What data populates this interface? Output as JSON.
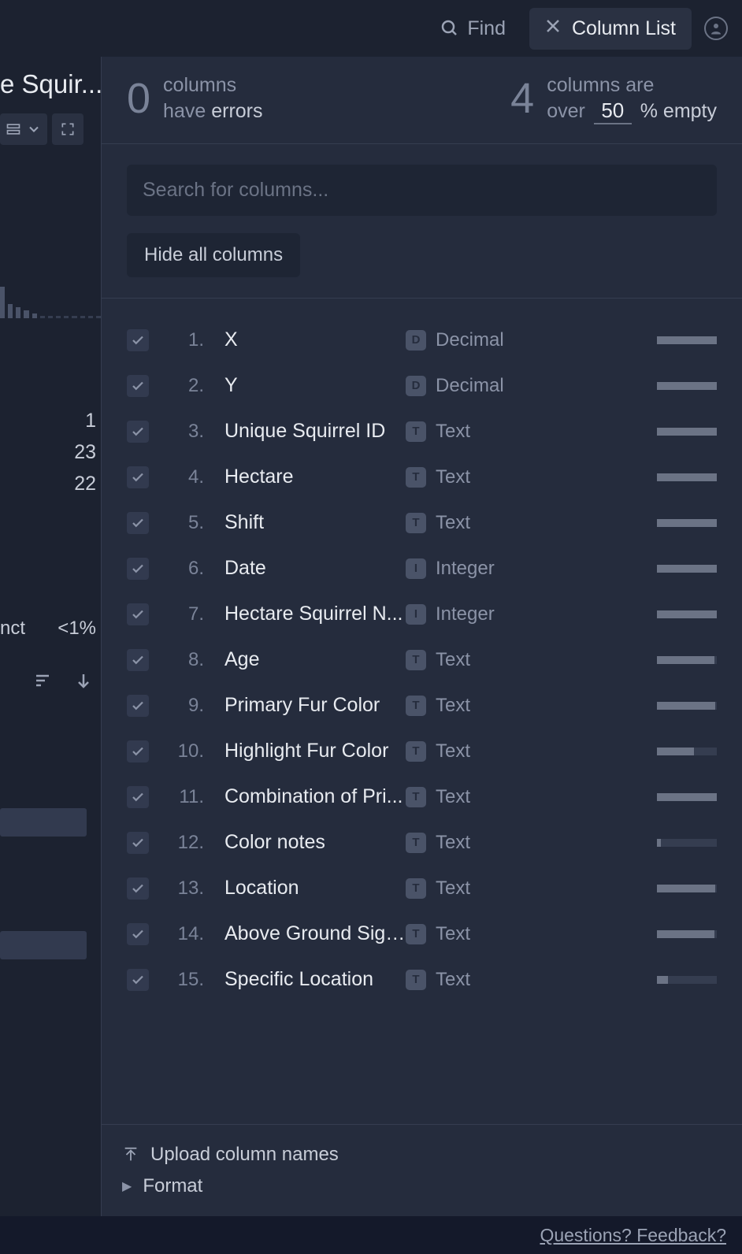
{
  "topbar": {
    "find_label": "Find",
    "column_list_label": "Column List"
  },
  "left": {
    "title_fragment": "e Squir...",
    "nums": [
      "1",
      "23",
      "22"
    ],
    "nct": "nct",
    "pct": "<1%"
  },
  "stats": {
    "errors_count": "0",
    "errors_line1": "columns",
    "errors_line2": "have errors",
    "empty_count": "4",
    "empty_line1": "columns are",
    "empty_prefix": "over",
    "empty_threshold": "50",
    "empty_suffix": "% empty"
  },
  "search": {
    "placeholder": "Search for columns...",
    "hide_label": "Hide all columns"
  },
  "columns": [
    {
      "num": "1.",
      "name": "X",
      "type_badge": "D",
      "type_label": "Decimal",
      "fill": 100,
      "checked": true
    },
    {
      "num": "2.",
      "name": "Y",
      "type_badge": "D",
      "type_label": "Decimal",
      "fill": 100,
      "checked": true
    },
    {
      "num": "3.",
      "name": "Unique Squirrel ID",
      "type_badge": "T",
      "type_label": "Text",
      "fill": 100,
      "checked": true
    },
    {
      "num": "4.",
      "name": "Hectare",
      "type_badge": "T",
      "type_label": "Text",
      "fill": 100,
      "checked": true
    },
    {
      "num": "5.",
      "name": "Shift",
      "type_badge": "T",
      "type_label": "Text",
      "fill": 100,
      "checked": true
    },
    {
      "num": "6.",
      "name": "Date",
      "type_badge": "I",
      "type_label": "Integer",
      "fill": 100,
      "checked": true
    },
    {
      "num": "7.",
      "name": "Hectare Squirrel N...",
      "type_badge": "I",
      "type_label": "Integer",
      "fill": 100,
      "checked": true
    },
    {
      "num": "8.",
      "name": "Age",
      "type_badge": "T",
      "type_label": "Text",
      "fill": 96,
      "checked": true
    },
    {
      "num": "9.",
      "name": "Primary Fur Color",
      "type_badge": "T",
      "type_label": "Text",
      "fill": 98,
      "checked": true
    },
    {
      "num": "10.",
      "name": "Highlight Fur Color",
      "type_badge": "T",
      "type_label": "Text",
      "fill": 62,
      "checked": true
    },
    {
      "num": "11.",
      "name": "Combination of Pri...",
      "type_badge": "T",
      "type_label": "Text",
      "fill": 100,
      "checked": true
    },
    {
      "num": "12.",
      "name": "Color notes",
      "type_badge": "T",
      "type_label": "Text",
      "fill": 6,
      "checked": true
    },
    {
      "num": "13.",
      "name": "Location",
      "type_badge": "T",
      "type_label": "Text",
      "fill": 98,
      "checked": true
    },
    {
      "num": "14.",
      "name": "Above Ground Sigh...",
      "type_badge": "T",
      "type_label": "Text",
      "fill": 96,
      "checked": true
    },
    {
      "num": "15.",
      "name": "Specific Location",
      "type_badge": "T",
      "type_label": "Text",
      "fill": 18,
      "checked": true
    }
  ],
  "footer": {
    "upload_label": "Upload column names",
    "format_label": "Format"
  },
  "bottom": {
    "feedback_label": "Questions? Feedback?"
  }
}
